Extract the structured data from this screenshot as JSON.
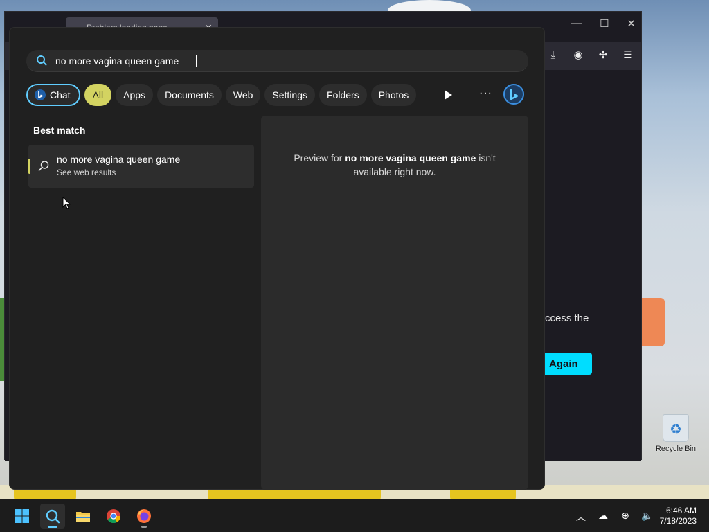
{
  "browser": {
    "tab_title": "Problem loading page",
    "body_text_fragment": "ccess the",
    "try_again_fragment": "Again"
  },
  "search": {
    "query": "no more vagina queen game",
    "filters": [
      "Chat",
      "All",
      "Apps",
      "Documents",
      "Web",
      "Settings",
      "Folders",
      "Photos"
    ],
    "best_match_label": "Best match",
    "result_title": "no more vagina queen game",
    "result_subtitle": "See web results",
    "preview_prefix": "Preview for ",
    "preview_query": "no more vagina queen game",
    "preview_suffix": " isn't available right now."
  },
  "desktop": {
    "recycle_bin_label": "Recycle Bin"
  },
  "taskbar": {
    "time": "6:46 AM",
    "date": "7/18/2023",
    "apps": [
      "windows-start-icon",
      "search-icon",
      "file-explorer-icon",
      "chrome-icon",
      "firefox-icon"
    ]
  },
  "colors": {
    "accent": "#d3d361",
    "chat_border": "#60cdff",
    "try_again_button": "#00ddff"
  }
}
